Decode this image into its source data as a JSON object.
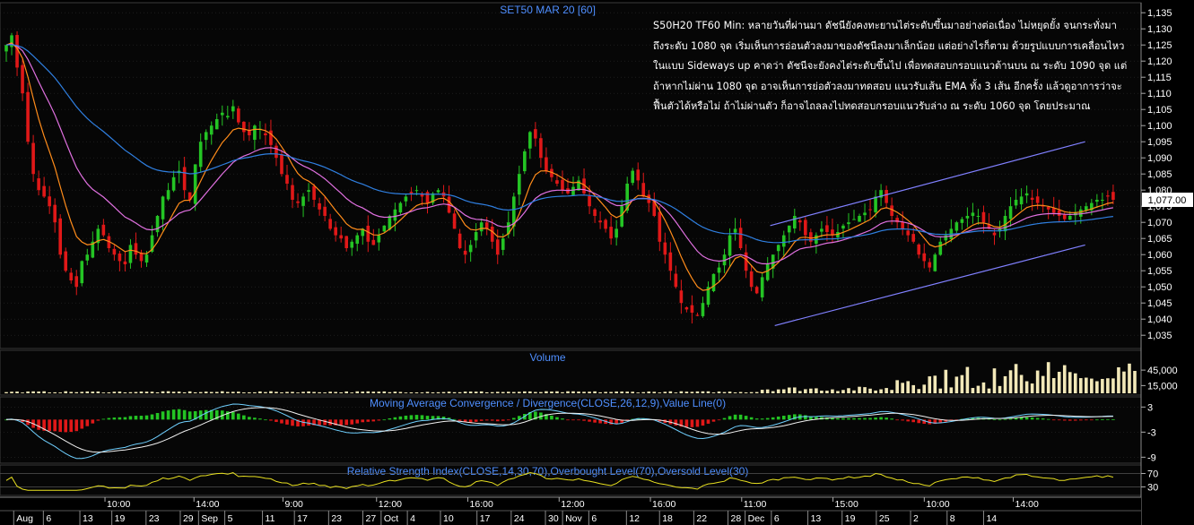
{
  "chart_data": [
    {
      "type": "candlestick",
      "title": "SET50 MAR 20   [60]",
      "y_ticks": [
        1035,
        1040,
        1045,
        1050,
        1055,
        1060,
        1065,
        1070,
        1075,
        1080,
        1085,
        1090,
        1095,
        1100,
        1105,
        1110,
        1115,
        1120,
        1125,
        1130,
        1135
      ],
      "ylim": [
        1032,
        1137
      ],
      "last_price_label": "1,077.00",
      "last_price": 1077,
      "candle_count": 210,
      "close_series": [
        1125,
        1128,
        1118,
        1110,
        1095,
        1085,
        1080,
        1078,
        1075,
        1070,
        1060,
        1055,
        1052,
        1050,
        1058,
        1060,
        1064,
        1068,
        1066,
        1062,
        1060,
        1058,
        1057,
        1063,
        1060,
        1058,
        1060,
        1066,
        1072,
        1078,
        1080,
        1084,
        1086,
        1080,
        1077,
        1088,
        1095,
        1098,
        1100,
        1102,
        1104,
        1103,
        1106,
        1101,
        1098,
        1097,
        1100,
        1099,
        1097,
        1094,
        1090,
        1085,
        1082,
        1077,
        1076,
        1078,
        1080,
        1077,
        1074,
        1072,
        1068,
        1066,
        1065,
        1062,
        1064,
        1066,
        1068,
        1064,
        1063,
        1066,
        1069,
        1072,
        1074,
        1076,
        1078,
        1079,
        1080,
        1078,
        1076,
        1079,
        1080,
        1078,
        1073,
        1068,
        1062,
        1060,
        1063,
        1067,
        1070,
        1068,
        1064,
        1060,
        1065,
        1070,
        1078,
        1085,
        1092,
        1098,
        1096,
        1090,
        1086,
        1084,
        1082,
        1080,
        1079,
        1081,
        1083,
        1079,
        1075,
        1072,
        1070,
        1068,
        1065,
        1068,
        1075,
        1082,
        1086,
        1083,
        1078,
        1076,
        1072,
        1064,
        1060,
        1055,
        1050,
        1045,
        1043,
        1042,
        1041,
        1045,
        1050,
        1054,
        1056,
        1060,
        1066,
        1068,
        1062,
        1055,
        1050,
        1048,
        1053,
        1057,
        1060,
        1063,
        1066,
        1069,
        1072,
        1070,
        1066,
        1064,
        1066,
        1068,
        1067,
        1066,
        1067,
        1069,
        1070,
        1071,
        1072,
        1073,
        1074,
        1078,
        1080,
        1076,
        1072,
        1070,
        1068,
        1066,
        1064,
        1060,
        1058,
        1056,
        1060,
        1064,
        1066,
        1068,
        1070,
        1071,
        1072,
        1073,
        1072,
        1070,
        1068,
        1066,
        1068,
        1072,
        1075,
        1077,
        1078,
        1079,
        1077,
        1076,
        1075,
        1074,
        1073,
        1072,
        1071,
        1072,
        1073,
        1074,
        1075,
        1076,
        1077,
        1077,
        1078,
        1077
      ],
      "channel_upper": {
        "from": [
          0.675,
          1069
        ],
        "to": [
          0.951,
          1095
        ]
      },
      "channel_lower": {
        "from": [
          0.679,
          1038
        ],
        "to": [
          0.951,
          1063
        ]
      },
      "annotation_lines": [
        "S50H20 TF60 Min: หลายวันที่ผ่านมา ดัชนียังคงทะยานไต่ระดับขึ้นมาอย่างต่อเนื่อง ไม่หยุดยั้ง จนกระทั่งมา",
        "ถึงระดับ 1080 จุด เริ่มเห็นการอ่อนตัวลงมาของดัชนีลงมาเล็กน้อย แต่อย่างไรก็ตาม ด้วยรูปแบบการเคลื่อนไหว",
        "ในแบบ Sideways up คาดว่า ดัชนีจะยังคงไต่ระดับขึ้นไป เพื่อทดสอบกรอบแนวต้านบน ณ ระดับ 1090 จุด แต่",
        "ถ้าหากไม่ผ่าน 1080 จุด อาจเห็นการย่อตัวลงมาทดสอบ แนวรับเส้น EMA ทั้ง 3 เส้น อีกครั้ง แล้วดูอาการว่าจะ",
        "ฟื้นตัวได้หรือไม่ ถ้าไม่ผ่านตัว ก็อาจไถลลงไปทดสอบกรอบแนวรับล่าง ณ ระดับ 1060 จุด โดยประมาณ"
      ]
    },
    {
      "type": "bar",
      "title": "Volume",
      "y_ticks": [
        "45,000",
        "15,000"
      ],
      "y_tick_values": [
        45000,
        15000
      ],
      "ylim": [
        0,
        80000
      ]
    },
    {
      "type": "line",
      "title": "Moving Average Convergence / Divergence(CLOSE,26,12,9),Value Line(0)",
      "y_ticks": [
        "3",
        "-3",
        "-9"
      ],
      "y_tick_values": [
        3,
        -3,
        -9
      ],
      "ylim": [
        -10,
        5
      ]
    },
    {
      "type": "line",
      "title": "Relative Strength Index(CLOSE,14,30,70),Overbought Level(70),Oversold Level(30)",
      "y_ticks": [
        "70",
        "30"
      ],
      "y_tick_values": [
        70,
        30
      ],
      "ylim": [
        10,
        90
      ]
    }
  ],
  "time_axis": {
    "upper": [
      {
        "pos": 0.092,
        "label": "10:00"
      },
      {
        "pos": 0.17,
        "label": "14:00"
      },
      {
        "pos": 0.248,
        "label": "9:00"
      },
      {
        "pos": 0.33,
        "label": "12:00"
      },
      {
        "pos": 0.41,
        "label": "16:00"
      },
      {
        "pos": 0.49,
        "label": "12:00"
      },
      {
        "pos": 0.57,
        "label": "16:00"
      },
      {
        "pos": 0.65,
        "label": "11:00"
      },
      {
        "pos": 0.73,
        "label": "15:00"
      },
      {
        "pos": 0.81,
        "label": "10:00"
      },
      {
        "pos": 0.888,
        "label": "14:00"
      }
    ],
    "lower": [
      {
        "pos": 0.012,
        "label": "Aug"
      },
      {
        "pos": 0.038,
        "label": "6"
      },
      {
        "pos": 0.07,
        "label": "13"
      },
      {
        "pos": 0.098,
        "label": "19"
      },
      {
        "pos": 0.128,
        "label": "23"
      },
      {
        "pos": 0.158,
        "label": "29"
      },
      {
        "pos": 0.174,
        "label": "Sep"
      },
      {
        "pos": 0.197,
        "label": "5"
      },
      {
        "pos": 0.23,
        "label": "11"
      },
      {
        "pos": 0.258,
        "label": "17"
      },
      {
        "pos": 0.288,
        "label": "23"
      },
      {
        "pos": 0.318,
        "label": "27"
      },
      {
        "pos": 0.334,
        "label": "Oct"
      },
      {
        "pos": 0.357,
        "label": "4"
      },
      {
        "pos": 0.386,
        "label": "10"
      },
      {
        "pos": 0.418,
        "label": "17"
      },
      {
        "pos": 0.448,
        "label": "24"
      },
      {
        "pos": 0.478,
        "label": "30"
      },
      {
        "pos": 0.493,
        "label": "Nov"
      },
      {
        "pos": 0.516,
        "label": "6"
      },
      {
        "pos": 0.549,
        "label": "12"
      },
      {
        "pos": 0.578,
        "label": "18"
      },
      {
        "pos": 0.608,
        "label": "22"
      },
      {
        "pos": 0.638,
        "label": "28"
      },
      {
        "pos": 0.653,
        "label": "Dec"
      },
      {
        "pos": 0.676,
        "label": "6"
      },
      {
        "pos": 0.708,
        "label": "13"
      },
      {
        "pos": 0.738,
        "label": "19"
      },
      {
        "pos": 0.768,
        "label": "25"
      },
      {
        "pos": 0.798,
        "label": "2"
      },
      {
        "pos": 0.83,
        "label": "8"
      },
      {
        "pos": 0.862,
        "label": "14"
      }
    ]
  },
  "colors": {
    "background": "#000000",
    "panel_bg": "#060606",
    "grid": "#2a2a2a",
    "up": "#24c424",
    "down": "#e01818",
    "ema_short": "#ff8c1a",
    "ema_mid": "#e070e0",
    "ema_long": "#2f7fe0",
    "channel": "#8080ff",
    "title": "#4f8fff",
    "volume": "#f2e8b8",
    "macd_line": "#6fd0ff",
    "signal_line": "#f0f0f0",
    "rsi": "#e8e020",
    "axis_text": "#ffffff"
  }
}
